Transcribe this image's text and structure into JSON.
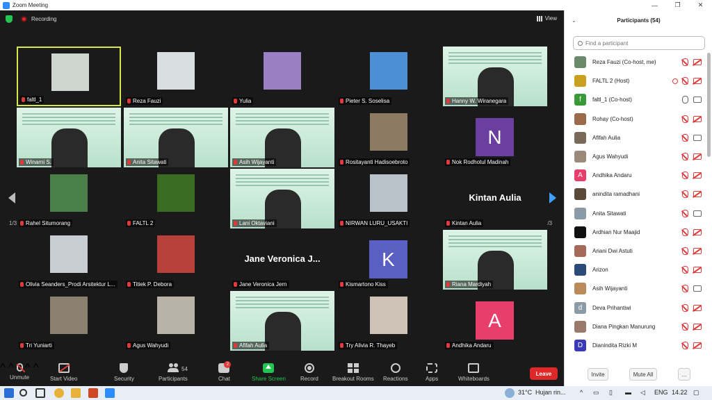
{
  "window": {
    "title": "Zoom Meeting",
    "controls": [
      "—",
      "❐",
      "✕"
    ]
  },
  "meeting_top": {
    "recording_label": "Recording",
    "view_label": "View",
    "page_left": "1/3",
    "page_right": "1/3"
  },
  "tiles": [
    {
      "name": "faltl_1",
      "kind": "video",
      "bg": "#cfd6cf"
    },
    {
      "name": "Reza Fauzi",
      "kind": "video",
      "bg": "#d9dee0"
    },
    {
      "name": "Yulia",
      "kind": "video",
      "bg": "#9a7fc4"
    },
    {
      "name": "Pieter S. Soselisa",
      "kind": "video",
      "bg": "#4d8fd4"
    },
    {
      "name": "Hanny W. Wiranegara",
      "kind": "slide",
      "bg": "#c9ead8"
    },
    {
      "name": "Winarni S.",
      "kind": "slide",
      "bg": "#c9ead8"
    },
    {
      "name": "Anita Sitawati",
      "kind": "slide",
      "bg": "#c9ead8"
    },
    {
      "name": "Asih Wijayanti",
      "kind": "slide",
      "bg": "#c9ead8"
    },
    {
      "name": "Rositayanti Hadisoebroto",
      "kind": "video",
      "bg": "#8d7a63"
    },
    {
      "name": "Nok Rodhotul Madinah",
      "kind": "avatar",
      "letter": "N",
      "bg": "#6b3fa0"
    },
    {
      "name": "Rahel Situmorang",
      "kind": "video",
      "bg": "#4a7f4a"
    },
    {
      "name": "FALTL 2",
      "kind": "video",
      "bg": "#3a6b22"
    },
    {
      "name": "Lani Oktaviani",
      "kind": "slide",
      "bg": "#c9ead8"
    },
    {
      "name": "NIRWAN LURU_USAKTI",
      "kind": "video",
      "bg": "#b9c2c9"
    },
    {
      "name": "Kintan Aulia",
      "kind": "text",
      "big": "Kintan Aulia"
    },
    {
      "name": "Olivia Seanders_Prodi Arsitektur L...",
      "kind": "video",
      "bg": "#c7cdd3"
    },
    {
      "name": "Titiek P. Debora",
      "kind": "video",
      "bg": "#b7413a"
    },
    {
      "name": "Jane Veronica Jern",
      "kind": "text",
      "big": "Jane Veronica J..."
    },
    {
      "name": "Kismartono Kiss",
      "kind": "avatar",
      "letter": "K",
      "bg": "#5a5fc4"
    },
    {
      "name": "Riana Mardiyah",
      "kind": "slide",
      "bg": "#c9ead8"
    },
    {
      "name": "Tri Yuniarti",
      "kind": "video",
      "bg": "#8a8070"
    },
    {
      "name": "Agus Wahyudi",
      "kind": "video",
      "bg": "#b9b2a6"
    },
    {
      "name": "Afifah Aulia",
      "kind": "slide",
      "bg": "#c9ead8"
    },
    {
      "name": "Try Alivia R. Thayeb",
      "kind": "video",
      "bg": "#cfc3b8"
    },
    {
      "name": "Andhika Andaru",
      "kind": "avatar",
      "letter": "A",
      "bg": "#e83e6c"
    }
  ],
  "toolbar": {
    "unmute": "Unmute",
    "start_video": "Start Video",
    "security": "Security",
    "participants": "Participants",
    "participants_count": "54",
    "chat": "Chat",
    "chat_badge": "2",
    "share_screen": "Share Screen",
    "record": "Record",
    "breakout_rooms": "Breakout Rooms",
    "reactions": "Reactions",
    "apps": "Apps",
    "whiteboards": "Whiteboards",
    "leave": "Leave"
  },
  "panel": {
    "title": "Participants (54)",
    "search_placeholder": "Find a participant",
    "participants": [
      {
        "name": "Reza Fauzi (Co-host, me)",
        "initial": "",
        "color": "#6b8a6b",
        "mic": false,
        "video": false
      },
      {
        "name": "FALTL 2 (Host)",
        "initial": "",
        "color": "#c9a020",
        "mic": false,
        "video": false,
        "sharing": true
      },
      {
        "name": "faltl_1 (Co-host)",
        "initial": "f",
        "color": "#3a9a3a",
        "mic": true,
        "video": true
      },
      {
        "name": "Rohay (Co-host)",
        "initial": "",
        "color": "#9a6a4a",
        "mic": false,
        "video": false
      },
      {
        "name": "Afifah Aulia",
        "initial": "",
        "color": "#7a6a5a",
        "mic": false,
        "video": true
      },
      {
        "name": "Agus Wahyudi",
        "initial": "",
        "color": "#9a8a7a",
        "mic": false,
        "video": false
      },
      {
        "name": "Andhika Andaru",
        "initial": "A",
        "color": "#e83e6c",
        "mic": false,
        "video": false
      },
      {
        "name": "anindita ramadhani",
        "initial": "",
        "color": "#5a4a3a",
        "mic": false,
        "video": false
      },
      {
        "name": "Anita Sitawati",
        "initial": "",
        "color": "#8a9aa6",
        "mic": false,
        "video": true
      },
      {
        "name": "Ardhian Nur Maajid",
        "initial": "",
        "color": "#111111",
        "mic": false,
        "video": false
      },
      {
        "name": "Ariani Dwi Astuti",
        "initial": "",
        "color": "#a66a5a",
        "mic": false,
        "video": false
      },
      {
        "name": "Arizon",
        "initial": "",
        "color": "#2a4a7a",
        "mic": false,
        "video": false
      },
      {
        "name": "Asih Wijayanti",
        "initial": "",
        "color": "#b98a5a",
        "mic": false,
        "video": true
      },
      {
        "name": "Deva Prihantiwi",
        "initial": "d",
        "color": "#8a9aa6",
        "mic": false,
        "video": false
      },
      {
        "name": "Diana Pingkan Manurung",
        "initial": "",
        "color": "#9a7a6a",
        "mic": false,
        "video": false
      },
      {
        "name": "Dianindita Rizki M",
        "initial": "D",
        "color": "#3a3ab9",
        "mic": false,
        "video": false
      }
    ],
    "invite": "Invite",
    "mute_all": "Mute All",
    "more": "..."
  },
  "taskbar": {
    "temperature": "31°C",
    "weather": "Hujan rin...",
    "language": "ENG",
    "time": "14.22"
  }
}
